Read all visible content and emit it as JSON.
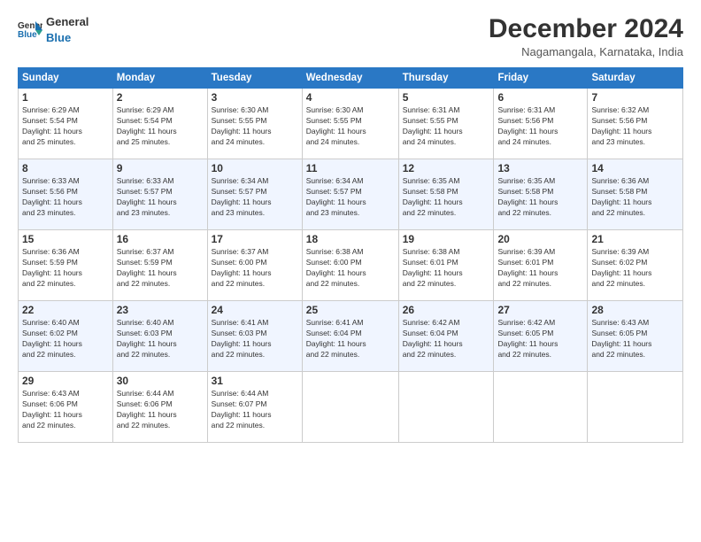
{
  "logo": {
    "general": "General",
    "blue": "Blue"
  },
  "header": {
    "title": "December 2024",
    "subtitle": "Nagamangala, Karnataka, India"
  },
  "weekdays": [
    "Sunday",
    "Monday",
    "Tuesday",
    "Wednesday",
    "Thursday",
    "Friday",
    "Saturday"
  ],
  "weeks": [
    [
      {
        "day": "1",
        "sunrise": "6:29 AM",
        "sunset": "5:54 PM",
        "daylight": "11 hours and 25 minutes."
      },
      {
        "day": "2",
        "sunrise": "6:29 AM",
        "sunset": "5:54 PM",
        "daylight": "11 hours and 25 minutes."
      },
      {
        "day": "3",
        "sunrise": "6:30 AM",
        "sunset": "5:55 PM",
        "daylight": "11 hours and 24 minutes."
      },
      {
        "day": "4",
        "sunrise": "6:30 AM",
        "sunset": "5:55 PM",
        "daylight": "11 hours and 24 minutes."
      },
      {
        "day": "5",
        "sunrise": "6:31 AM",
        "sunset": "5:55 PM",
        "daylight": "11 hours and 24 minutes."
      },
      {
        "day": "6",
        "sunrise": "6:31 AM",
        "sunset": "5:56 PM",
        "daylight": "11 hours and 24 minutes."
      },
      {
        "day": "7",
        "sunrise": "6:32 AM",
        "sunset": "5:56 PM",
        "daylight": "11 hours and 23 minutes."
      }
    ],
    [
      {
        "day": "8",
        "sunrise": "6:33 AM",
        "sunset": "5:56 PM",
        "daylight": "11 hours and 23 minutes."
      },
      {
        "day": "9",
        "sunrise": "6:33 AM",
        "sunset": "5:57 PM",
        "daylight": "11 hours and 23 minutes."
      },
      {
        "day": "10",
        "sunrise": "6:34 AM",
        "sunset": "5:57 PM",
        "daylight": "11 hours and 23 minutes."
      },
      {
        "day": "11",
        "sunrise": "6:34 AM",
        "sunset": "5:57 PM",
        "daylight": "11 hours and 23 minutes."
      },
      {
        "day": "12",
        "sunrise": "6:35 AM",
        "sunset": "5:58 PM",
        "daylight": "11 hours and 22 minutes."
      },
      {
        "day": "13",
        "sunrise": "6:35 AM",
        "sunset": "5:58 PM",
        "daylight": "11 hours and 22 minutes."
      },
      {
        "day": "14",
        "sunrise": "6:36 AM",
        "sunset": "5:58 PM",
        "daylight": "11 hours and 22 minutes."
      }
    ],
    [
      {
        "day": "15",
        "sunrise": "6:36 AM",
        "sunset": "5:59 PM",
        "daylight": "11 hours and 22 minutes."
      },
      {
        "day": "16",
        "sunrise": "6:37 AM",
        "sunset": "5:59 PM",
        "daylight": "11 hours and 22 minutes."
      },
      {
        "day": "17",
        "sunrise": "6:37 AM",
        "sunset": "6:00 PM",
        "daylight": "11 hours and 22 minutes."
      },
      {
        "day": "18",
        "sunrise": "6:38 AM",
        "sunset": "6:00 PM",
        "daylight": "11 hours and 22 minutes."
      },
      {
        "day": "19",
        "sunrise": "6:38 AM",
        "sunset": "6:01 PM",
        "daylight": "11 hours and 22 minutes."
      },
      {
        "day": "20",
        "sunrise": "6:39 AM",
        "sunset": "6:01 PM",
        "daylight": "11 hours and 22 minutes."
      },
      {
        "day": "21",
        "sunrise": "6:39 AM",
        "sunset": "6:02 PM",
        "daylight": "11 hours and 22 minutes."
      }
    ],
    [
      {
        "day": "22",
        "sunrise": "6:40 AM",
        "sunset": "6:02 PM",
        "daylight": "11 hours and 22 minutes."
      },
      {
        "day": "23",
        "sunrise": "6:40 AM",
        "sunset": "6:03 PM",
        "daylight": "11 hours and 22 minutes."
      },
      {
        "day": "24",
        "sunrise": "6:41 AM",
        "sunset": "6:03 PM",
        "daylight": "11 hours and 22 minutes."
      },
      {
        "day": "25",
        "sunrise": "6:41 AM",
        "sunset": "6:04 PM",
        "daylight": "11 hours and 22 minutes."
      },
      {
        "day": "26",
        "sunrise": "6:42 AM",
        "sunset": "6:04 PM",
        "daylight": "11 hours and 22 minutes."
      },
      {
        "day": "27",
        "sunrise": "6:42 AM",
        "sunset": "6:05 PM",
        "daylight": "11 hours and 22 minutes."
      },
      {
        "day": "28",
        "sunrise": "6:43 AM",
        "sunset": "6:05 PM",
        "daylight": "11 hours and 22 minutes."
      }
    ],
    [
      {
        "day": "29",
        "sunrise": "6:43 AM",
        "sunset": "6:06 PM",
        "daylight": "11 hours and 22 minutes."
      },
      {
        "day": "30",
        "sunrise": "6:44 AM",
        "sunset": "6:06 PM",
        "daylight": "11 hours and 22 minutes."
      },
      {
        "day": "31",
        "sunrise": "6:44 AM",
        "sunset": "6:07 PM",
        "daylight": "11 hours and 22 minutes."
      },
      null,
      null,
      null,
      null
    ]
  ],
  "labels": {
    "sunrise": "Sunrise:",
    "sunset": "Sunset:",
    "daylight": "Daylight:"
  }
}
